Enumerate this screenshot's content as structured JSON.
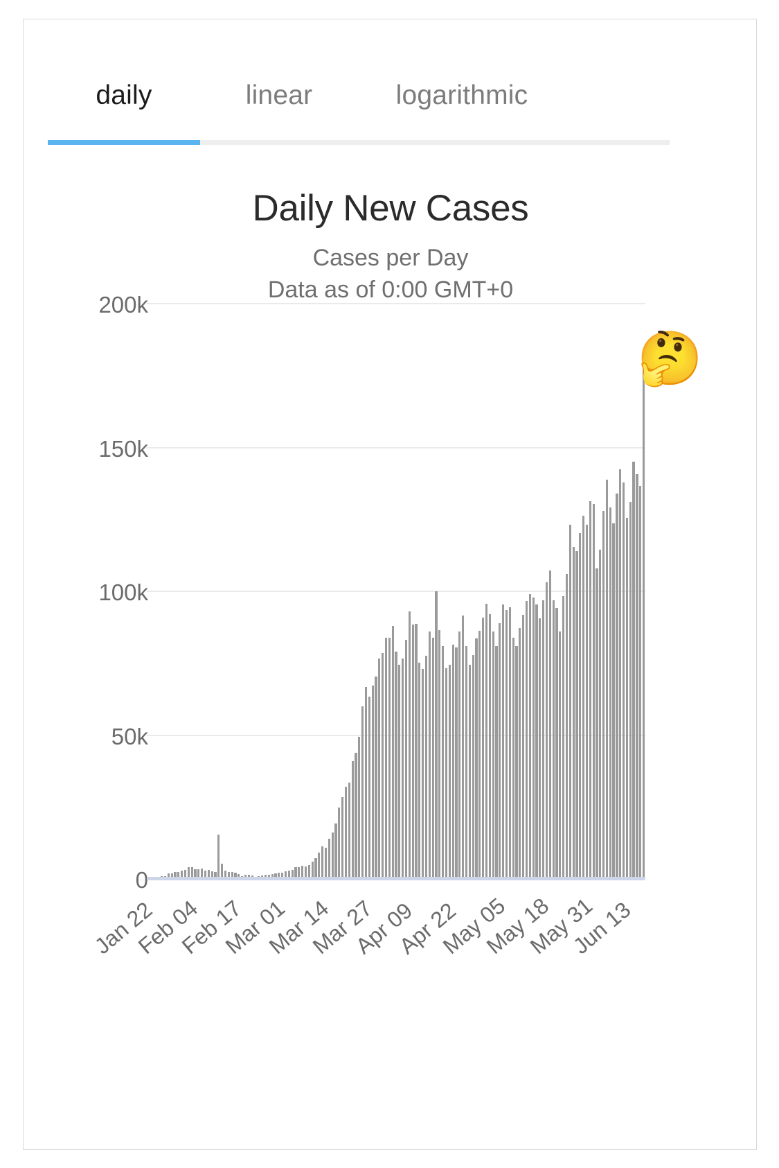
{
  "tabs": [
    {
      "label": "daily",
      "active": true
    },
    {
      "label": "linear",
      "active": false
    },
    {
      "label": "logarithmic",
      "active": false
    }
  ],
  "accent_color": "#5ab4f0",
  "bar_color": "#9a9a9a",
  "overlay": {
    "emoji": "🤔",
    "name": "thinking-face-emoji"
  },
  "chart_data": {
    "type": "bar",
    "title": "Daily New Cases",
    "subtitle": "Cases per Day",
    "subtitle2": "Data as of 0:00 GMT+0",
    "xlabel": "",
    "ylabel": "",
    "ylim": [
      0,
      200000
    ],
    "grid": true,
    "legend": "none",
    "ytick_labels": [
      "200k",
      "150k",
      "100k",
      "50k",
      "0"
    ],
    "ytick_values": [
      200000,
      150000,
      100000,
      50000,
      0
    ],
    "xtick_labels": [
      "Jan 22",
      "Feb 04",
      "Feb 17",
      "Mar 01",
      "Mar 14",
      "Mar 27",
      "Apr 09",
      "Apr 22",
      "May 05",
      "May 18",
      "May 31",
      "Jun 13"
    ],
    "xtick_indices": [
      0,
      13,
      26,
      39,
      52,
      65,
      78,
      91,
      104,
      117,
      130,
      143
    ],
    "categories": [
      "Jan 22",
      "Jan 23",
      "Jan 24",
      "Jan 25",
      "Jan 26",
      "Jan 27",
      "Jan 28",
      "Jan 29",
      "Jan 30",
      "Jan 31",
      "Feb 01",
      "Feb 02",
      "Feb 03",
      "Feb 04",
      "Feb 05",
      "Feb 06",
      "Feb 07",
      "Feb 08",
      "Feb 09",
      "Feb 10",
      "Feb 11",
      "Feb 12",
      "Feb 13",
      "Feb 14",
      "Feb 15",
      "Feb 16",
      "Feb 17",
      "Feb 18",
      "Feb 19",
      "Feb 20",
      "Feb 21",
      "Feb 22",
      "Feb 23",
      "Feb 24",
      "Feb 25",
      "Feb 26",
      "Feb 27",
      "Feb 28",
      "Feb 29",
      "Mar 01",
      "Mar 02",
      "Mar 03",
      "Mar 04",
      "Mar 05",
      "Mar 06",
      "Mar 07",
      "Mar 08",
      "Mar 09",
      "Mar 10",
      "Mar 11",
      "Mar 12",
      "Mar 13",
      "Mar 14",
      "Mar 15",
      "Mar 16",
      "Mar 17",
      "Mar 18",
      "Mar 19",
      "Mar 20",
      "Mar 21",
      "Mar 22",
      "Mar 23",
      "Mar 24",
      "Mar 25",
      "Mar 26",
      "Mar 27",
      "Mar 28",
      "Mar 29",
      "Mar 30",
      "Mar 31",
      "Apr 01",
      "Apr 02",
      "Apr 03",
      "Apr 04",
      "Apr 05",
      "Apr 06",
      "Apr 07",
      "Apr 08",
      "Apr 09",
      "Apr 10",
      "Apr 11",
      "Apr 12",
      "Apr 13",
      "Apr 14",
      "Apr 15",
      "Apr 16",
      "Apr 17",
      "Apr 18",
      "Apr 19",
      "Apr 20",
      "Apr 21",
      "Apr 22",
      "Apr 23",
      "Apr 24",
      "Apr 25",
      "Apr 26",
      "Apr 27",
      "Apr 28",
      "Apr 29",
      "Apr 30",
      "May 01",
      "May 02",
      "May 03",
      "May 04",
      "May 05",
      "May 06",
      "May 07",
      "May 08",
      "May 09",
      "May 10",
      "May 11",
      "May 12",
      "May 13",
      "May 14",
      "May 15",
      "May 16",
      "May 17",
      "May 18",
      "May 19",
      "May 20",
      "May 21",
      "May 22",
      "May 23",
      "May 24",
      "May 25",
      "May 26",
      "May 27",
      "May 28",
      "May 29",
      "May 30",
      "May 31",
      "Jun 01",
      "Jun 02",
      "Jun 03",
      "Jun 04",
      "Jun 05",
      "Jun 06",
      "Jun 07",
      "Jun 08",
      "Jun 09",
      "Jun 10",
      "Jun 11",
      "Jun 12",
      "Jun 13",
      "Jun 14",
      "Jun 15",
      "Jun 16",
      "Jun 17",
      "Jun 18"
    ],
    "values": [
      100,
      300,
      400,
      500,
      700,
      800,
      1800,
      1700,
      2100,
      2100,
      2600,
      2800,
      3900,
      3800,
      3200,
      3200,
      3400,
      2700,
      3000,
      2500,
      2100,
      15100,
      5100,
      2700,
      2200,
      2100,
      1900,
      1500,
      800,
      1100,
      1200,
      1000,
      600,
      800,
      900,
      1200,
      1200,
      1400,
      1800,
      2000,
      2000,
      2300,
      2700,
      3000,
      3800,
      3900,
      4400,
      4100,
      4700,
      5700,
      7000,
      9000,
      11200,
      10500,
      13700,
      15800,
      19000,
      24600,
      28100,
      31700,
      33300,
      40700,
      43700,
      49200,
      59700,
      66600,
      63200,
      67100,
      70100,
      76400,
      78200,
      83500,
      83600,
      87600,
      78700,
      74300,
      76400,
      82800,
      92800,
      88100,
      88500,
      74900,
      72700,
      77400,
      85800,
      83500,
      99800,
      86200,
      80700,
      72900,
      74200,
      81100,
      80300,
      85700,
      91400,
      80700,
      74300,
      77500,
      83300,
      86000,
      90600,
      95500,
      91900,
      85900,
      80800,
      88600,
      95100,
      93200,
      94200,
      83700,
      80700,
      87000,
      91600,
      96500,
      98900,
      97500,
      95100,
      90300,
      96700,
      102800,
      107100,
      96600,
      93900,
      85900,
      98000,
      105800,
      122900,
      115200,
      113800,
      120000,
      126000,
      123000,
      131000,
      130100,
      107800,
      114200,
      127800,
      138600,
      129000,
      123300,
      133700,
      142200,
      137700,
      125400,
      130800,
      144800,
      140600,
      136300,
      183000
    ]
  }
}
